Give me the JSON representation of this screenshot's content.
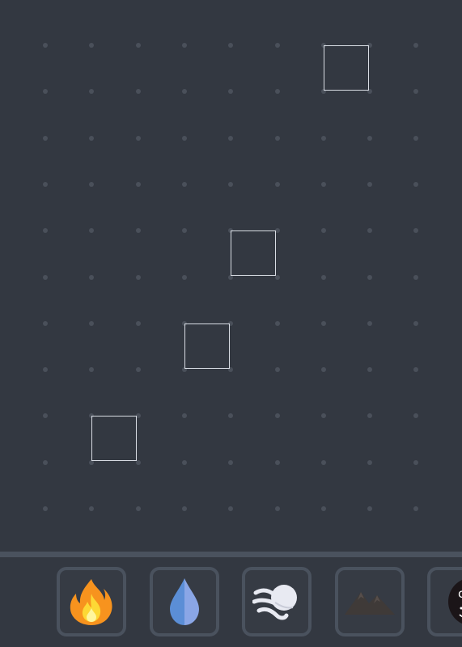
{
  "board": {
    "cols": 9,
    "rows": 11,
    "selected_cells": [
      {
        "col": 6,
        "row": 0
      },
      {
        "col": 4,
        "row": 4
      },
      {
        "col": 3,
        "row": 6
      },
      {
        "col": 1,
        "row": 8
      }
    ]
  },
  "tray": {
    "items": [
      {
        "name": "fire",
        "icon": "fire-icon"
      },
      {
        "name": "water",
        "icon": "water-drop-icon"
      },
      {
        "name": "wind",
        "icon": "wind-icon"
      },
      {
        "name": "earth",
        "icon": "mountain-icon"
      },
      {
        "name": "cosmic",
        "icon": "cosmic-face-icon",
        "label": "co"
      }
    ]
  },
  "colors": {
    "background": "#333841",
    "dot": "#4a505a",
    "cell_border": "#d9dde4",
    "divider": "#4a525e",
    "slot_border": "#4a525e"
  }
}
